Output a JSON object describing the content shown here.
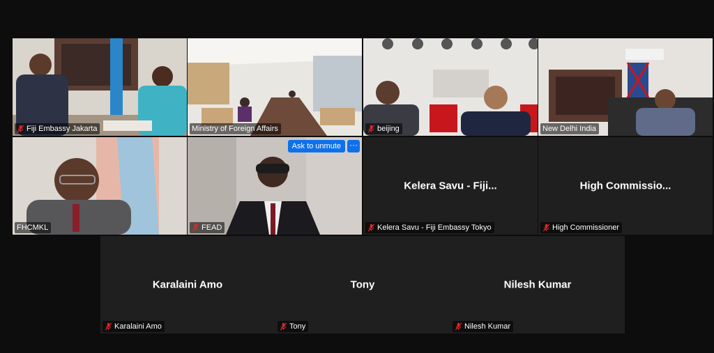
{
  "participants": [
    {
      "display": "Fiji Embassy Jakarta",
      "tile_name": "",
      "muted": true,
      "video": true,
      "speaking": false
    },
    {
      "display": "Ministry of Foreign Affairs",
      "tile_name": "",
      "muted": false,
      "video": true,
      "speaking": true
    },
    {
      "display": "beijing",
      "tile_name": "",
      "muted": true,
      "video": true,
      "speaking": false
    },
    {
      "display": "New Delhi India",
      "tile_name": "",
      "muted": false,
      "video": true,
      "speaking": false
    },
    {
      "display": "FHCMKL",
      "tile_name": "",
      "muted": false,
      "video": true,
      "speaking": false
    },
    {
      "display": "FEAD",
      "tile_name": "",
      "muted": true,
      "video": true,
      "speaking": false
    },
    {
      "display": "Kelera Savu - Fiji Embassy Tokyo",
      "tile_name": "Kelera Savu - Fiji...",
      "muted": true,
      "video": false,
      "speaking": false
    },
    {
      "display": "High Commissioner",
      "tile_name": "High  Commissio...",
      "muted": true,
      "video": false,
      "speaking": false
    },
    {
      "display": "Karalaini Amo",
      "tile_name": "Karalaini Amo",
      "muted": true,
      "video": false,
      "speaking": false
    },
    {
      "display": "Tony",
      "tile_name": "Tony",
      "muted": true,
      "video": false,
      "speaking": false
    },
    {
      "display": "Nilesh Kumar",
      "tile_name": "Nilesh Kumar",
      "muted": true,
      "video": false,
      "speaking": false
    }
  ],
  "hover_controls": {
    "unmute_label": "Ask to unmute",
    "more_label": "···"
  },
  "icons": {
    "muted_mic": "muted-mic-icon"
  },
  "colors": {
    "speaking_border": "#23d959",
    "muted_mic": "#e02828",
    "button_blue": "#0e71eb"
  }
}
